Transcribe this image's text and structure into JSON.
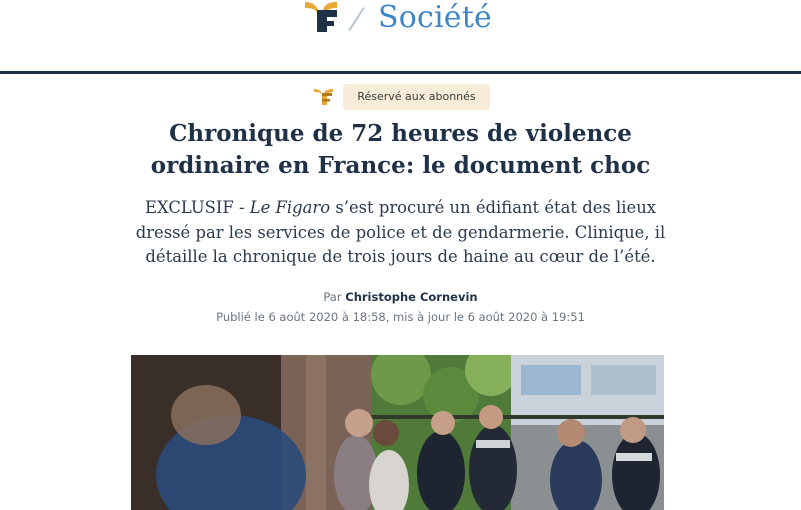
{
  "header": {
    "logo_icon": "le-figaro-f-logo",
    "separator": "/",
    "section": "Société"
  },
  "badge": {
    "icon": "le-figaro-f-logo",
    "label": "Réservé aux abonnés",
    "background": "#f7ecd7"
  },
  "article": {
    "title": "Chronique de 72 heures de violence ordinaire en France: le document choc",
    "lede": {
      "prefix": "EXCLUSIF - ",
      "italic": "Le Figaro",
      "rest": " s’est procuré un édifiant état des lieux dressé par les services de police et de gendarmerie. Clinique, il détaille la chronique de trois jours de haine au cœur de l’été."
    },
    "byline": {
      "by": "Par ",
      "author": "Christophe Cornevin"
    },
    "dates": "Publié le 6 août 2020 à 18:58, mis à jour le 6 août 2020 à 19:51"
  },
  "photo": {
    "description": "article-photo-police"
  },
  "colors": {
    "brand_navy": "#1f3147",
    "section_blue": "#3f86c8",
    "logo_gold": "#e8a937"
  }
}
